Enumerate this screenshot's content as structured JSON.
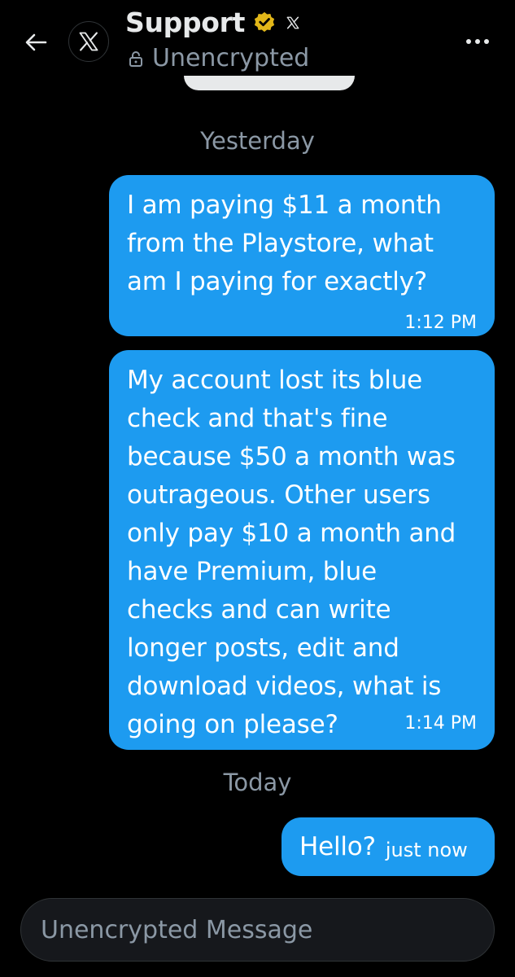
{
  "header": {
    "title": "Support",
    "subtitle": "Unencrypted",
    "icons": {
      "back": "back-arrow-icon",
      "avatar": "x-logo",
      "verified": "verified-badge-icon",
      "affiliate": "x-logo-small",
      "lock": "lock-icon",
      "more": "more-dots-icon"
    }
  },
  "dates": {
    "yesterday": "Yesterday",
    "today": "Today"
  },
  "messages": [
    {
      "text": "I am paying $11 a month\nfrom the Playstore, what\nam I paying for exactly?",
      "time": "1:12 PM"
    },
    {
      "text": "My account lost its blue\ncheck and that's fine\nbecause $50 a month was\noutrageous.  Other users\nonly pay $10 a month and\nhave Premium, blue\nchecks and can write\nlonger posts, edit and\ndownload videos, what is\ngoing on please?",
      "time": "1:14 PM"
    },
    {
      "text": "Hello?",
      "time": "just now"
    }
  ],
  "composer": {
    "placeholder": "Unencrypted Message"
  },
  "colors": {
    "background": "#000000",
    "bubble": "#1d9bf0",
    "muted_text": "#8b98a5",
    "verified_gold": "#e2b719"
  }
}
